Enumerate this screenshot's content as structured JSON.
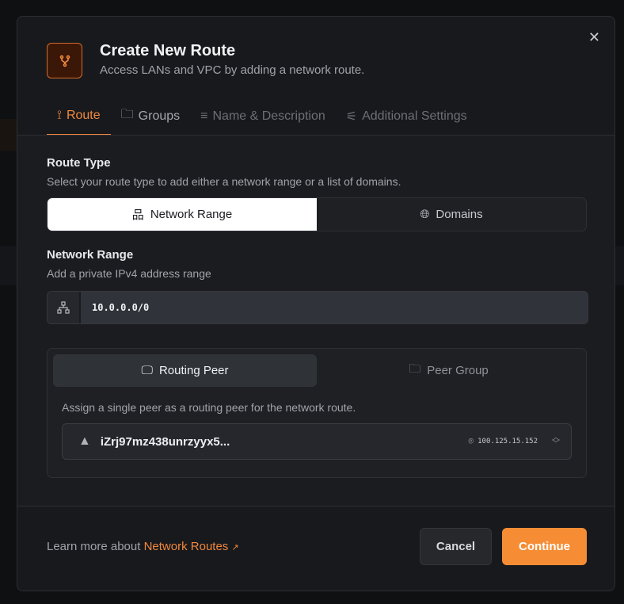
{
  "dialog": {
    "title": "Create New Route",
    "subtitle": "Access LANs and VPC by adding a network route.",
    "close_icon": "close-icon"
  },
  "tabs": [
    {
      "label": "Route",
      "icon": "route-icon"
    },
    {
      "label": "Groups",
      "icon": "folder-icon"
    },
    {
      "label": "Name & Description",
      "icon": "text-icon"
    },
    {
      "label": "Additional Settings",
      "icon": "settings-icon"
    }
  ],
  "route_type": {
    "label": "Route Type",
    "description": "Select your route type to add either a network range or a list of domains.",
    "options": [
      "Network Range",
      "Domains"
    ],
    "selected": "Network Range"
  },
  "network_range": {
    "label": "Network Range",
    "description": "Add a private IPv4 address range",
    "value": "10.0.0.0/0"
  },
  "peer": {
    "tabs": [
      "Routing Peer",
      "Peer Group"
    ],
    "selected": "Routing Peer",
    "description": "Assign a single peer as a routing peer for the network route.",
    "selected_peer": "iZrj97mz438unrzyyx5...",
    "peer_ip": "100.125.15.152"
  },
  "footer": {
    "learn_text": "Learn more about",
    "learn_link": "Network Routes",
    "cancel": "Cancel",
    "continue": "Continue"
  },
  "colors": {
    "accent": "#f68d35"
  }
}
